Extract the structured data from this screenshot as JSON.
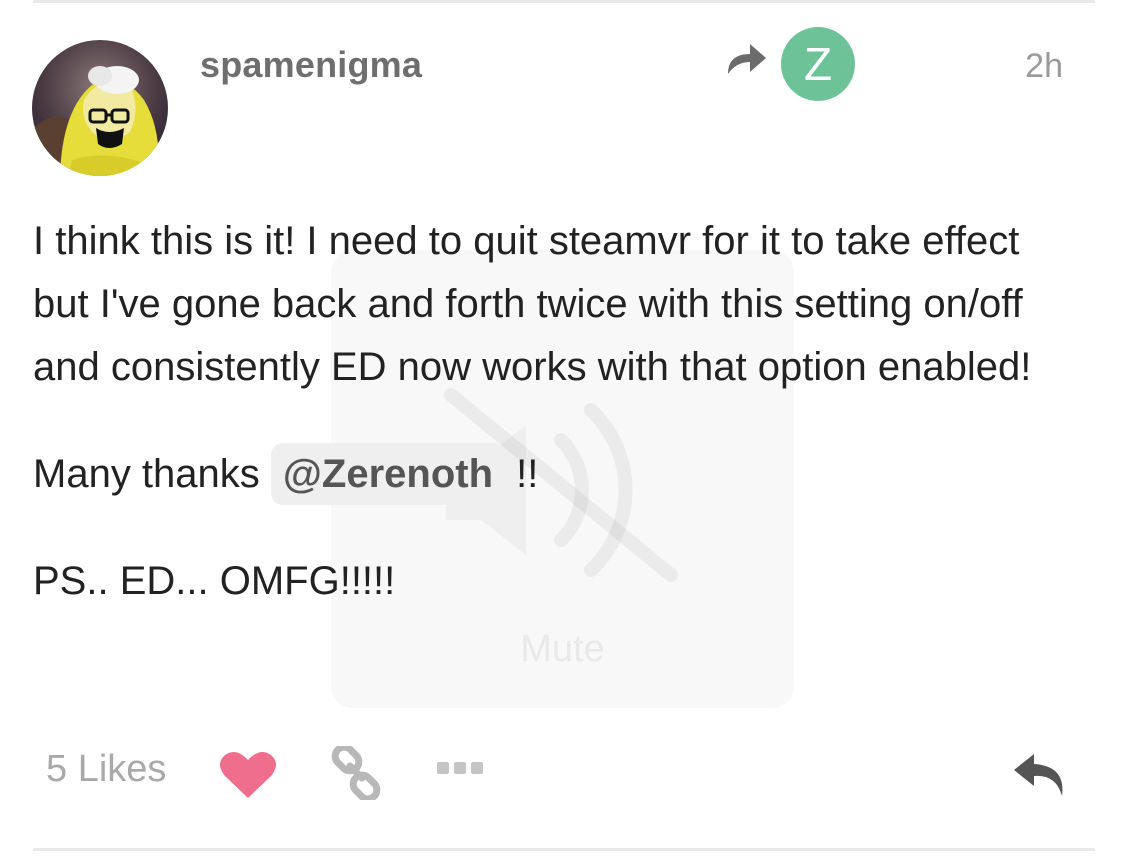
{
  "post": {
    "username": "spamenigma",
    "time": "2h",
    "reply_to_avatar_letter": "Z",
    "paragraph1": "I think this is it! I need to quit steamvr for it to take effect but I've gone back and forth twice with this setting on/off and consistently ED now works with that option enabled!",
    "thanks_prefix": "Many thanks ",
    "mention": "@Zerenoth",
    "thanks_suffix": " !!",
    "paragraph3": "PS.. ED... OMFG!!!!!"
  },
  "actions": {
    "likes_label": "5 Likes",
    "icons": [
      "heart-icon",
      "link-icon",
      "more-icon",
      "reply-icon"
    ]
  },
  "overlay": {
    "mute_label": "Mute"
  },
  "colors": {
    "heart": "#f06e8d",
    "reply_avatar": "#6dc298",
    "username": "#6e6e6e",
    "muted_text": "#a9a9a9"
  }
}
